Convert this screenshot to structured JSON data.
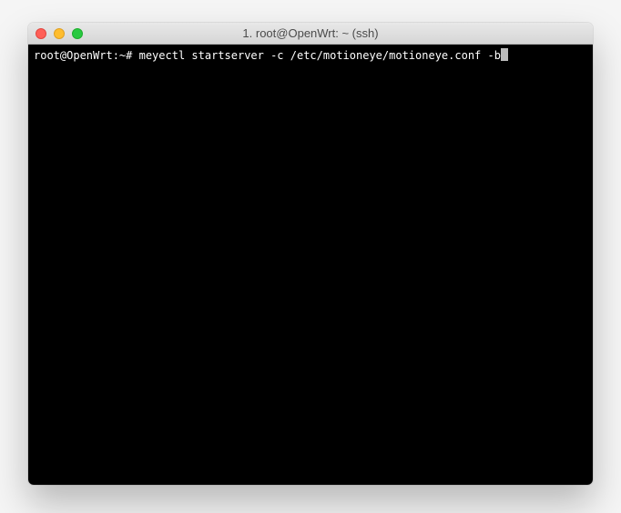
{
  "window": {
    "title": "1. root@OpenWrt: ~ (ssh)"
  },
  "terminal": {
    "prompt": "root@OpenWrt:~# ",
    "command": "meyectl startserver -c /etc/motioneye/motioneye.conf -b"
  },
  "colors": {
    "terminal_bg": "#000000",
    "terminal_fg": "#ffffff",
    "cursor": "#bbbbbb"
  }
}
